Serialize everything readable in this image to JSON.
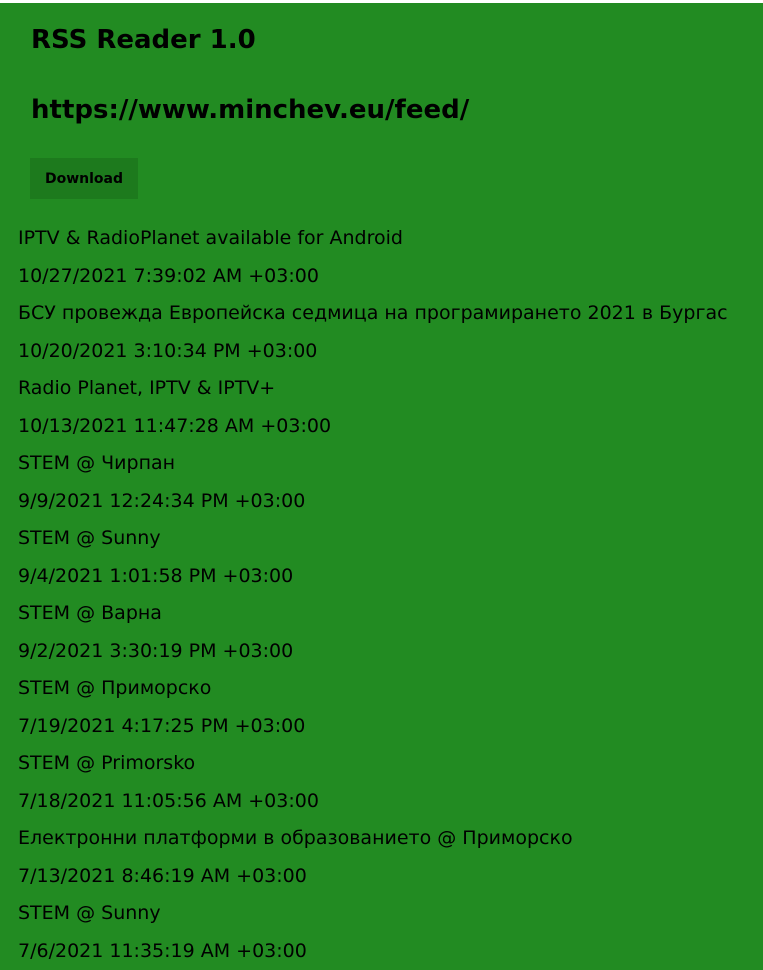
{
  "app": {
    "title": "RSS Reader 1.0",
    "feed_url": "https://www.minchev.eu/feed/",
    "download_label": "Download",
    "background_color": "#228b22"
  },
  "feed_items": [
    {
      "title": "IPTV & RadioPlanet available for Android",
      "date": "10/27/2021 7:39:02 AM +03:00"
    },
    {
      "title": "БСУ провежда Европейска седмица на програмирането 2021 в Бургас",
      "date": "10/20/2021 3:10:34 PM +03:00"
    },
    {
      "title": "Radio Planet, IPTV & IPTV+",
      "date": "10/13/2021 11:47:28 AM +03:00"
    },
    {
      "title": "STEM @ Чирпан",
      "date": "9/9/2021 12:24:34 PM +03:00"
    },
    {
      "title": "STEM @ Sunny",
      "date": "9/4/2021 1:01:58 PM +03:00"
    },
    {
      "title": "STEM @ Варна",
      "date": "9/2/2021 3:30:19 PM +03:00"
    },
    {
      "title": "STEM @ Приморско",
      "date": "7/19/2021 4:17:25 PM +03:00"
    },
    {
      "title": "STEM @ Primorsko",
      "date": "7/18/2021 11:05:56 AM +03:00"
    },
    {
      "title": "Електронни платформи в образованието @ Приморско",
      "date": "7/13/2021 8:46:19 AM +03:00"
    },
    {
      "title": "STEM @ Sunny",
      "date": "7/6/2021 11:35:19 AM +03:00"
    }
  ]
}
